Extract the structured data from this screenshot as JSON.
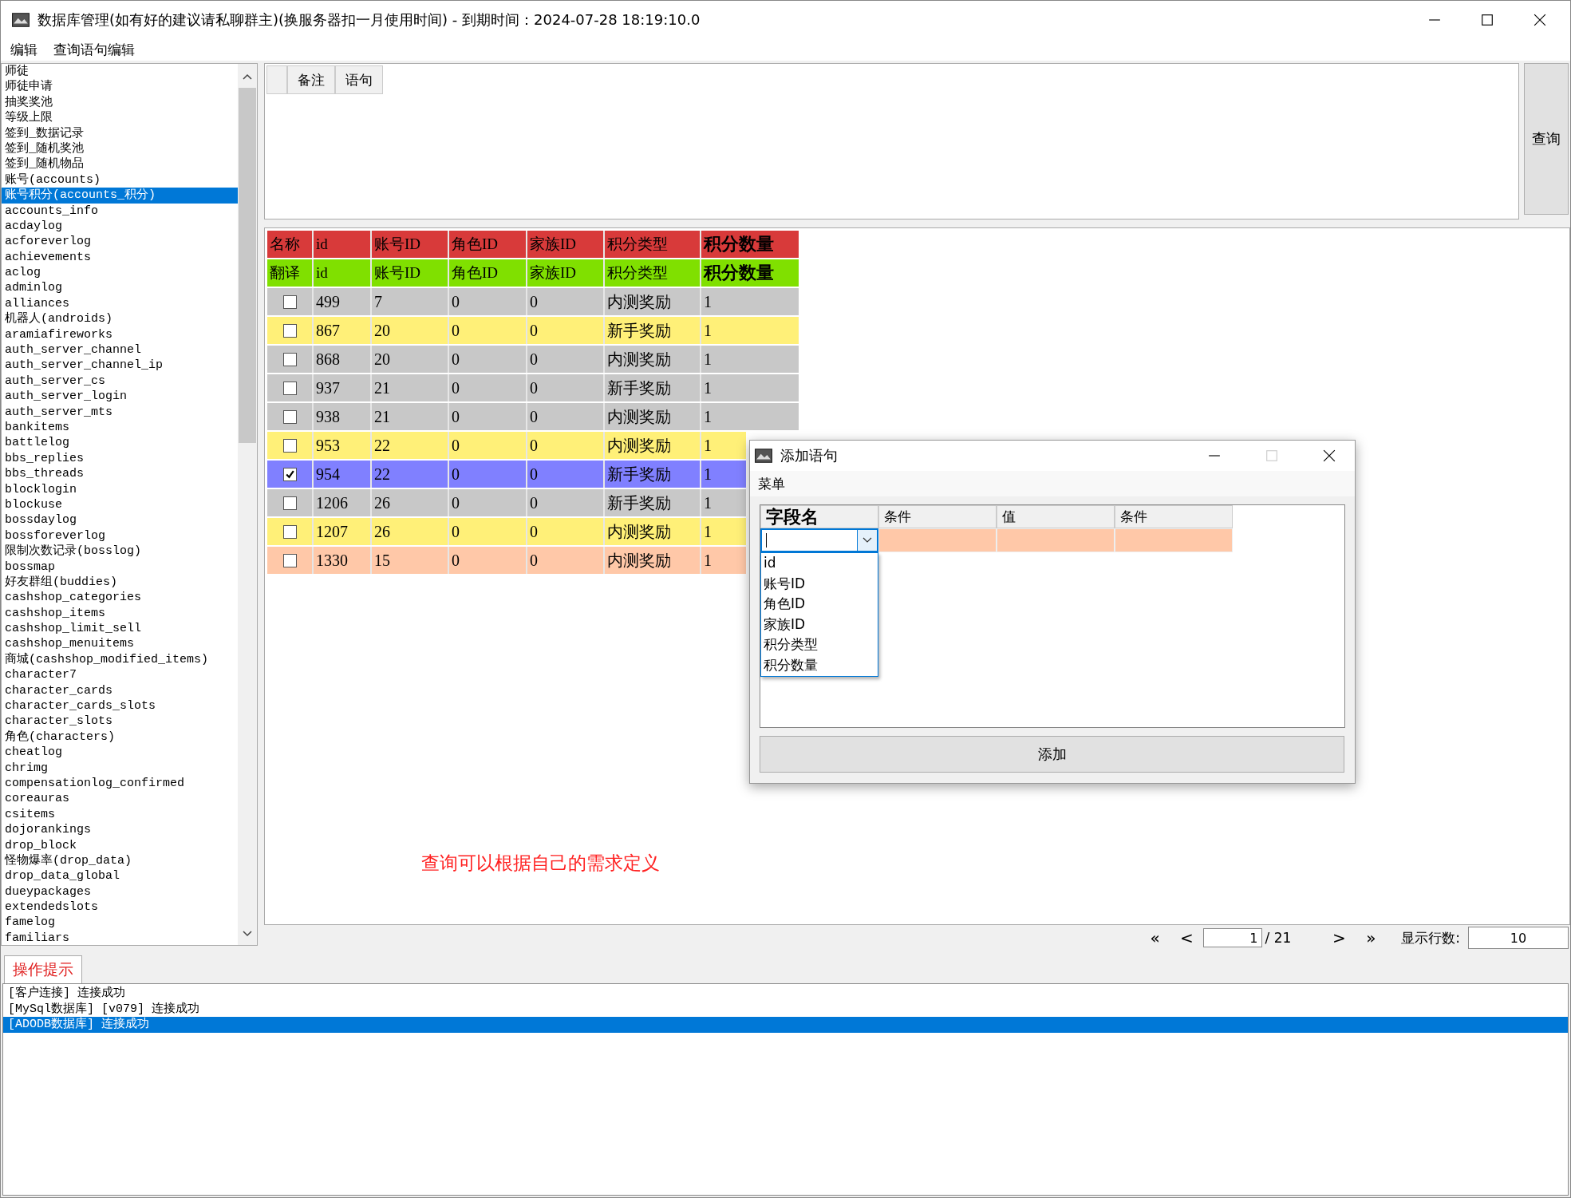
{
  "window": {
    "title": "数据库管理(如有好的建议请私聊群主)(换服务器扣一月使用时间) - 到期时间：2024-07-28 18:19:10.0"
  },
  "menu": [
    "编辑",
    "查询语句编辑"
  ],
  "tables": [
    {
      "name": "师徒",
      "selected": false
    },
    {
      "name": "师徒申请",
      "selected": false
    },
    {
      "name": "抽奖奖池",
      "selected": false
    },
    {
      "name": "等级上限",
      "selected": false
    },
    {
      "name": "签到_数据记录",
      "selected": false
    },
    {
      "name": "签到_随机奖池",
      "selected": false
    },
    {
      "name": "签到_随机物品",
      "selected": false
    },
    {
      "name": "账号(accounts)",
      "selected": false
    },
    {
      "name": "账号积分(accounts_积分)",
      "selected": true
    },
    {
      "name": "accounts_info",
      "selected": false
    },
    {
      "name": "acdaylog",
      "selected": false
    },
    {
      "name": "acforeverlog",
      "selected": false
    },
    {
      "name": "achievements",
      "selected": false
    },
    {
      "name": "aclog",
      "selected": false
    },
    {
      "name": "adminlog",
      "selected": false
    },
    {
      "name": "alliances",
      "selected": false
    },
    {
      "name": "机器人(androids)",
      "selected": false
    },
    {
      "name": "aramiafireworks",
      "selected": false
    },
    {
      "name": "auth_server_channel",
      "selected": false
    },
    {
      "name": "auth_server_channel_ip",
      "selected": false
    },
    {
      "name": "auth_server_cs",
      "selected": false
    },
    {
      "name": "auth_server_login",
      "selected": false
    },
    {
      "name": "auth_server_mts",
      "selected": false
    },
    {
      "name": "bankitems",
      "selected": false
    },
    {
      "name": "battlelog",
      "selected": false
    },
    {
      "name": "bbs_replies",
      "selected": false
    },
    {
      "name": "bbs_threads",
      "selected": false
    },
    {
      "name": "blocklogin",
      "selected": false
    },
    {
      "name": "blockuse",
      "selected": false
    },
    {
      "name": "bossdaylog",
      "selected": false
    },
    {
      "name": "bossforeverlog",
      "selected": false
    },
    {
      "name": "限制次数记录(bosslog)",
      "selected": false
    },
    {
      "name": "bossmap",
      "selected": false
    },
    {
      "name": "好友群组(buddies)",
      "selected": false
    },
    {
      "name": "cashshop_categories",
      "selected": false
    },
    {
      "name": "cashshop_items",
      "selected": false
    },
    {
      "name": "cashshop_limit_sell",
      "selected": false
    },
    {
      "name": "cashshop_menuitems",
      "selected": false
    },
    {
      "name": "商城(cashshop_modified_items)",
      "selected": false
    },
    {
      "name": "character7",
      "selected": false
    },
    {
      "name": "character_cards",
      "selected": false
    },
    {
      "name": "character_cards_slots",
      "selected": false
    },
    {
      "name": "character_slots",
      "selected": false
    },
    {
      "name": "角色(characters)",
      "selected": false
    },
    {
      "name": "cheatlog",
      "selected": false
    },
    {
      "name": "chrimg",
      "selected": false
    },
    {
      "name": "compensationlog_confirmed",
      "selected": false
    },
    {
      "name": "coreauras",
      "selected": false
    },
    {
      "name": "csitems",
      "selected": false
    },
    {
      "name": "dojorankings",
      "selected": false
    },
    {
      "name": "drop_block",
      "selected": false
    },
    {
      "name": "怪物爆率(drop_data)",
      "selected": false
    },
    {
      "name": "drop_data_global",
      "selected": false
    },
    {
      "name": "dueypackages",
      "selected": false
    },
    {
      "name": "extendedslots",
      "selected": false
    },
    {
      "name": "famelog",
      "selected": false
    },
    {
      "name": "familiars",
      "selected": false
    }
  ],
  "query_panel": {
    "tabs": [
      "备注",
      "语句"
    ],
    "button": "查询"
  },
  "grid": {
    "header_rows": [
      {
        "label": "名称",
        "color": "#d83a3a",
        "cells": [
          "id",
          "账号ID",
          "角色ID",
          "家族ID",
          "积分类型",
          "积分数量"
        ]
      },
      {
        "label": "翻译",
        "color": "#80e000",
        "cells": [
          "id",
          "账号ID",
          "角色ID",
          "家族ID",
          "积分类型",
          "积分数量"
        ]
      }
    ],
    "rows": [
      {
        "checked": false,
        "color": "#c8c8c8",
        "cells": [
          "499",
          "7",
          "0",
          "0",
          "内测奖励",
          "1"
        ]
      },
      {
        "checked": false,
        "color": "#fff078",
        "cells": [
          "867",
          "20",
          "0",
          "0",
          "新手奖励",
          "1"
        ]
      },
      {
        "checked": false,
        "color": "#c8c8c8",
        "cells": [
          "868",
          "20",
          "0",
          "0",
          "内测奖励",
          "1"
        ]
      },
      {
        "checked": false,
        "color": "#c8c8c8",
        "cells": [
          "937",
          "21",
          "0",
          "0",
          "新手奖励",
          "1"
        ]
      },
      {
        "checked": false,
        "color": "#c8c8c8",
        "cells": [
          "938",
          "21",
          "0",
          "0",
          "内测奖励",
          "1"
        ]
      },
      {
        "checked": false,
        "color": "#fff078",
        "cells": [
          "953",
          "22",
          "0",
          "0",
          "内测奖励",
          "1"
        ]
      },
      {
        "checked": true,
        "color": "#8080ff",
        "cells": [
          "954",
          "22",
          "0",
          "0",
          "新手奖励",
          "1"
        ]
      },
      {
        "checked": false,
        "color": "#c8c8c8",
        "cells": [
          "1206",
          "26",
          "0",
          "0",
          "新手奖励",
          "1"
        ]
      },
      {
        "checked": false,
        "color": "#fff078",
        "cells": [
          "1207",
          "26",
          "0",
          "0",
          "内测奖励",
          "1"
        ]
      },
      {
        "checked": false,
        "color": "#ffc8a8",
        "cells": [
          "1330",
          "15",
          "0",
          "0",
          "内测奖励",
          "1"
        ]
      }
    ]
  },
  "note": "查询可以根据自己的需求定义",
  "pager": {
    "first": "«",
    "prev": "<",
    "page": "1",
    "total": "/ 21",
    "next": ">",
    "last": "»",
    "rows_label": "显示行数:",
    "rows_value": "10"
  },
  "log": {
    "tab": "操作提示",
    "lines": [
      {
        "text": "[客户连接] 连接成功",
        "selected": false
      },
      {
        "text": "[MySql数据库] [v079] 连接成功",
        "selected": false
      },
      {
        "text": "[ADODB数据库] 连接成功",
        "selected": true
      }
    ]
  },
  "dialog": {
    "title": "添加语句",
    "menu": "菜单",
    "columns": [
      "字段名",
      "条件",
      "值",
      "条件"
    ],
    "options": [
      "id",
      "账号ID",
      "角色ID",
      "家族ID",
      "积分类型",
      "积分数量"
    ],
    "button": "添加"
  }
}
